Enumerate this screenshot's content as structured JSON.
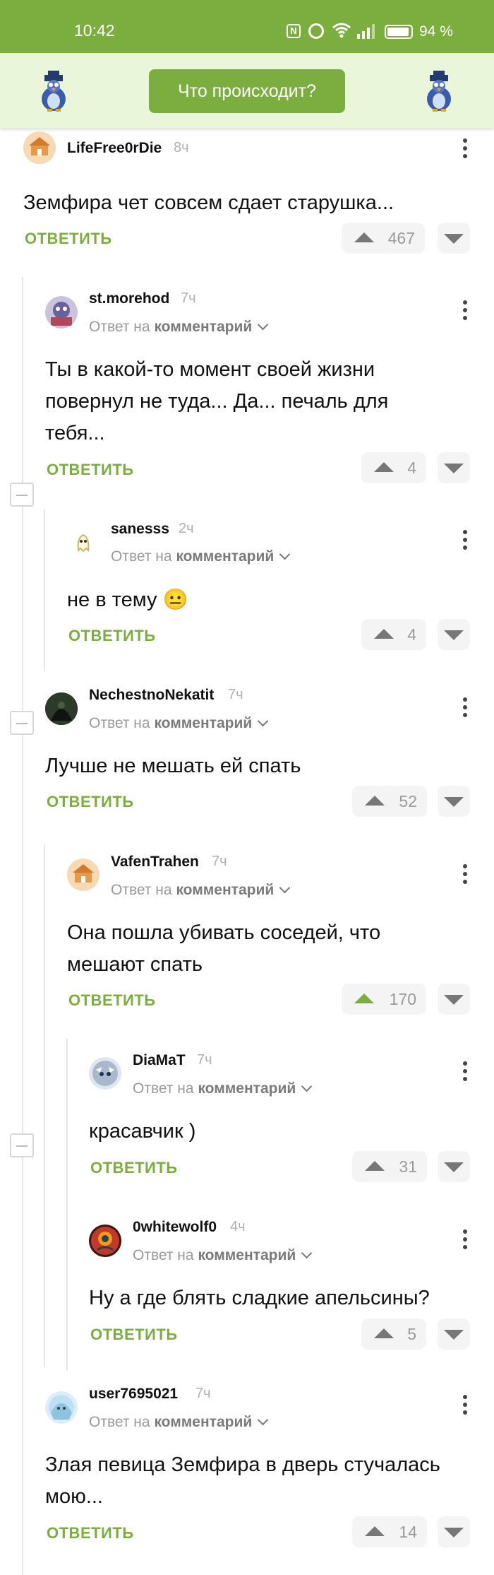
{
  "status_bar": {
    "time": "10:42",
    "battery": "94 %",
    "nfc_label": "N"
  },
  "top_bar": {
    "button_label": "Что происходит?"
  },
  "labels": {
    "reply": "ОТВЕТИТЬ",
    "reply_to_prefix": "Ответ на",
    "reply_to_target": "комментарий"
  },
  "comments": [
    {
      "author": "LifeFree0rDie",
      "age": "8ч",
      "text": "Земфира чет совсем сдает старушка...",
      "votes": "467"
    },
    {
      "author": "st.morehod",
      "age": "7ч",
      "text": "Ты в какой-то момент своей жизни повернул не туда... Да... печаль для тебя...",
      "votes": "4"
    },
    {
      "author": "sanesss",
      "age": "2ч",
      "text": "не в тему 😐",
      "votes": "4"
    },
    {
      "author": "NechestnoNekatit",
      "age": "7ч",
      "text": "Лучше не мешать ей спать",
      "votes": "52"
    },
    {
      "author": "VafenTrahen",
      "age": "7ч",
      "text": "Она пошла убивать соседей, что мешают спать",
      "votes": "170"
    },
    {
      "author": "DiaMaT",
      "age": "7ч",
      "text": "красавчик )",
      "votes": "31"
    },
    {
      "author": "0whitewolf0",
      "age": "4ч",
      "text": "Ну а где блять сладкие апельсины?",
      "votes": "5"
    },
    {
      "author": "user7695021",
      "age": "7ч",
      "text": "Злая певица Земфира в дверь стучалась мою...",
      "votes": "14"
    }
  ],
  "colors": {
    "accent": "#7cae3f",
    "topbar_bg": "#eaf6da"
  }
}
